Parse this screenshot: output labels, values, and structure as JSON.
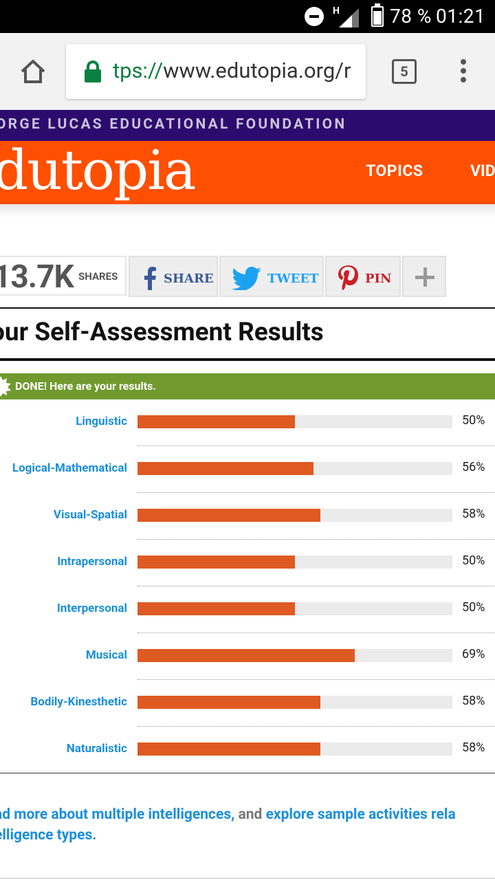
{
  "status_bar": {
    "network_type": "H",
    "battery_percent": "78 %",
    "time": "01:21"
  },
  "browser": {
    "url_scheme": "tps://",
    "url_host": "www.edutopia.org/r",
    "tab_count": "5"
  },
  "site": {
    "foundation_text": "ORGE LUCAS EDUCATIONAL FOUNDATION",
    "logo_text": "dutopia",
    "nav": [
      "TOPICS",
      "VID"
    ],
    "brand_color": "#ff4f00"
  },
  "share": {
    "count": "13.7K",
    "count_label": "SHARES",
    "facebook_label": "SHARE",
    "twitter_label": "TWEET",
    "pinterest_label": "PIN"
  },
  "results": {
    "title": "our Self-Assessment Results",
    "done_text": "DONE! Here are your results.",
    "bar_color": "#de5a22",
    "items": [
      {
        "label": "Linguistic",
        "percent_text": "50%",
        "value": 50
      },
      {
        "label": "Logical-Mathematical",
        "percent_text": "56%",
        "value": 56
      },
      {
        "label": "Visual-Spatial",
        "percent_text": "58%",
        "value": 58
      },
      {
        "label": "Intrapersonal",
        "percent_text": "50%",
        "value": 50
      },
      {
        "label": "Interpersonal",
        "percent_text": "50%",
        "value": 50
      },
      {
        "label": "Musical",
        "percent_text": "69%",
        "value": 69
      },
      {
        "label": "Bodily-Kinesthetic",
        "percent_text": "58%",
        "value": 58
      },
      {
        "label": "Naturalistic",
        "percent_text": "58%",
        "value": 58
      }
    ]
  },
  "more": {
    "link1": "ad more about multiple intelligences,",
    "connector": " and ",
    "link2": "explore sample activities rela",
    "link2_continued": "elligence types",
    "period": "."
  }
}
